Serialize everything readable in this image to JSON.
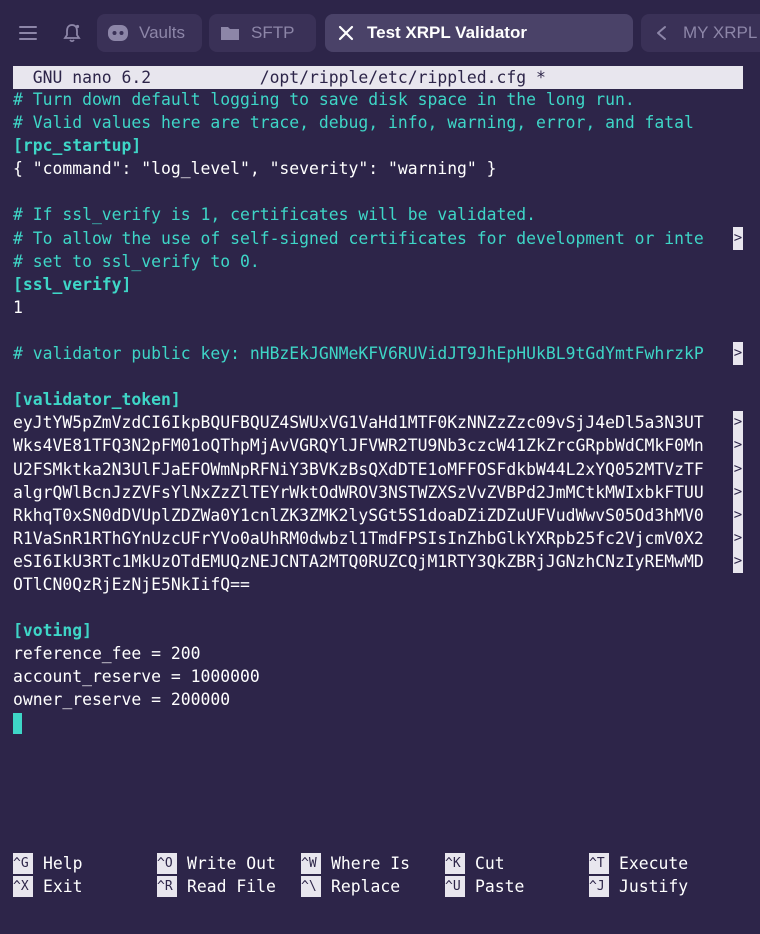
{
  "tabs": [
    {
      "label": "Vaults",
      "icon": "discord-vault-icon",
      "active": false
    },
    {
      "label": "SFTP",
      "icon": "folder-icon",
      "active": false
    },
    {
      "label": "Test XRPL Validator",
      "icon": "close-icon",
      "active": true
    },
    {
      "label": "MY XRPL",
      "icon": "terminal-icon",
      "active": false
    }
  ],
  "nano": {
    "title": "  GNU nano 6.2           /opt/ripple/etc/rippled.cfg *"
  },
  "editor": {
    "lines": [
      {
        "text": "# Turn down default logging to save disk space in the long run.",
        "kind": "comment",
        "trunc": false
      },
      {
        "text": "# Valid values here are trace, debug, info, warning, error, and fatal",
        "kind": "comment",
        "trunc": false
      },
      {
        "text": "[rpc_startup]",
        "kind": "section",
        "trunc": false
      },
      {
        "text": "{ \"command\": \"log_level\", \"severity\": \"warning\" }",
        "kind": "plain",
        "trunc": false
      },
      {
        "text": "",
        "kind": "plain",
        "trunc": false
      },
      {
        "text": "# If ssl_verify is 1, certificates will be validated.",
        "kind": "comment",
        "trunc": false
      },
      {
        "text": "# To allow the use of self-signed certificates for development or inte",
        "kind": "comment",
        "trunc": true
      },
      {
        "text": "# set to ssl_verify to 0.",
        "kind": "comment",
        "trunc": false
      },
      {
        "text": "[ssl_verify]",
        "kind": "section",
        "trunc": false
      },
      {
        "text": "1",
        "kind": "plain",
        "trunc": false
      },
      {
        "text": "",
        "kind": "plain",
        "trunc": false
      },
      {
        "text": "# validator public key: nHBzEkJGNMeKFV6RUVidJT9JhEpHUkBL9tGdYmtFwhrzkP",
        "kind": "comment",
        "trunc": true
      },
      {
        "text": "",
        "kind": "plain",
        "trunc": false
      },
      {
        "text": "[validator_token]",
        "kind": "section",
        "trunc": false
      },
      {
        "text": "eyJtYW5pZmVzdCI6IkpBQUFBQUZ4SWUxVG1VaHd1MTF0KzNNZzZzc09vSjJ4eDl5a3N3UT",
        "kind": "token",
        "trunc": true
      },
      {
        "text": "Wks4VE81TFQ3N2pFM01oQThpMjAvVGRQYlJFVWR2TU9Nb3czcW41ZkZrcGRpbWdCMkF0Mn",
        "kind": "token",
        "trunc": true
      },
      {
        "text": "U2FSMktka2N3UlFJaEFOWmNpRFNiY3BVKzBsQXdDTE1oMFFOSFdkbW44L2xYQ052MTVzTF",
        "kind": "token",
        "trunc": true
      },
      {
        "text": "algrQWlBcnJzZVFsYlNxZzZlTEYrWktOdWROV3NSTWZXSzVvZVBPd2JmMCtkMWIxbkFTUU",
        "kind": "token",
        "trunc": true
      },
      {
        "text": "RkhqT0xSN0dDVUplZDZWa0Y1cnlZK3ZMK2lySGt5S1doaDZiZDZuUFVudWwvS05Od3hMV0",
        "kind": "token",
        "trunc": true
      },
      {
        "text": "R1VaSnR1RThGYnUzcUFrYVo0aUhRM0dwbzl1TmdFPSIsInZhbGlkYXRpb25fc2VjcmV0X2",
        "kind": "token",
        "trunc": true
      },
      {
        "text": "eSI6IkU3RTc1MkUzOTdEMUQzNEJCNTA2MTQ0RUZCQjM1RTY3QkZBRjJGNzhCNzIyREMwMD",
        "kind": "token",
        "trunc": true
      },
      {
        "text": "OTlCN0QzRjEzNjE5NkIifQ==",
        "kind": "token",
        "trunc": false
      },
      {
        "text": "",
        "kind": "plain",
        "trunc": false
      },
      {
        "text": "[voting]",
        "kind": "section",
        "trunc": false
      },
      {
        "text": "reference_fee = 200",
        "kind": "plain",
        "trunc": false
      },
      {
        "text": "account_reserve = 1000000",
        "kind": "plain",
        "trunc": false
      },
      {
        "text": "owner_reserve = 200000",
        "kind": "plain",
        "trunc": false
      }
    ],
    "trunc_marker": ">"
  },
  "shortcuts": [
    [
      {
        "key": "^G",
        "label": "Help"
      },
      {
        "key": "^O",
        "label": "Write Out"
      },
      {
        "key": "^W",
        "label": "Where Is"
      },
      {
        "key": "^K",
        "label": "Cut"
      },
      {
        "key": "^T",
        "label": "Execute"
      }
    ],
    [
      {
        "key": "^X",
        "label": "Exit"
      },
      {
        "key": "^R",
        "label": "Read File"
      },
      {
        "key": "^\\",
        "label": "Replace"
      },
      {
        "key": "^U",
        "label": "Paste"
      },
      {
        "key": "^J",
        "label": "Justify"
      }
    ]
  ],
  "colors": {
    "background": "#2d2549",
    "comment": "#3ed6c7",
    "title_bar": "#e8e6ee"
  }
}
